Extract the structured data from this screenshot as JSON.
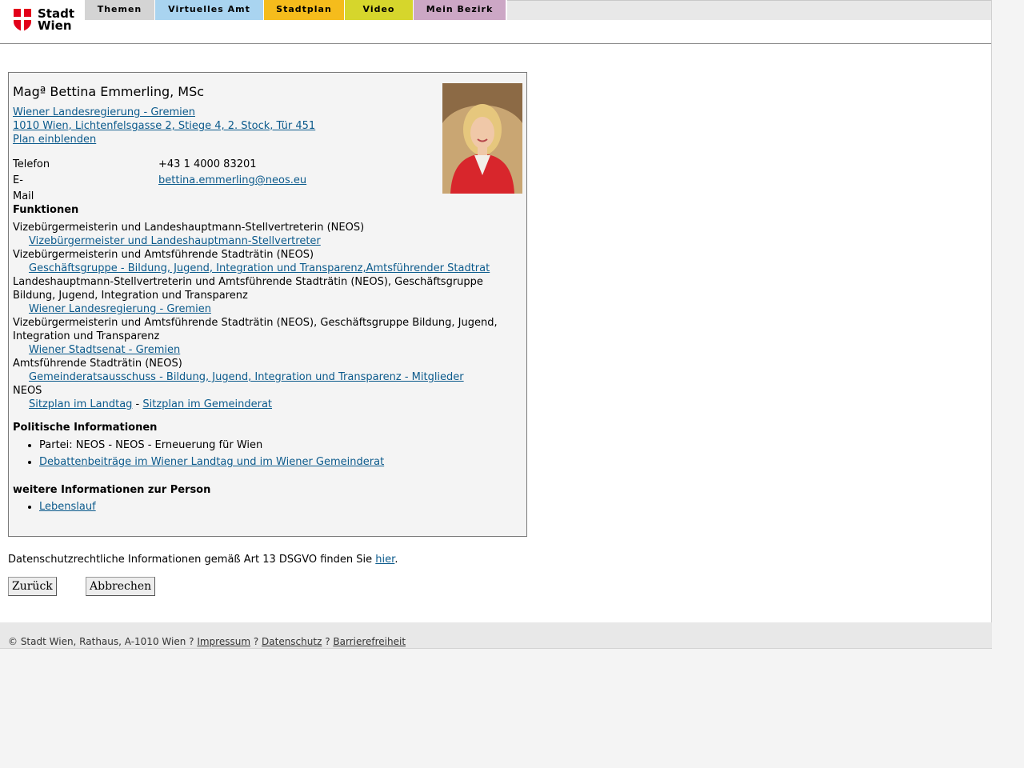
{
  "header": {
    "logo_text_line1": "Stadt",
    "logo_text_line2": "Wien",
    "tabs": [
      {
        "label": "Themen",
        "color": "#d4d4d4"
      },
      {
        "label": "Virtuelles Amt",
        "color": "#a9d4f0"
      },
      {
        "label": "Stadtplan",
        "color": "#f5bc1c"
      },
      {
        "label": "Video",
        "color": "#d6d62c"
      },
      {
        "label": "Mein Bezirk",
        "color": "#cca7c5"
      }
    ]
  },
  "person": {
    "name": "Magª Bettina Emmerling, MSc",
    "org_link": "Wiener Landesregierung - Gremien ",
    "address_link": "1010 Wien, Lichtenfelsgasse 2, Stiege 4, 2. Stock, Tür 451",
    "plan_link": "Plan einblenden",
    "phone_label": "Telefon",
    "phone_value": "+43 1 4000 83201",
    "email_label": "E-Mail",
    "email_value": "bettina.emmerling@neos.eu"
  },
  "functions": {
    "heading": "Funktionen",
    "items": [
      {
        "title": "Vizebürgermeisterin und Landeshauptmann-Stellvertreterin (NEOS)",
        "link": "Vizebürgermeister und Landeshauptmann-Stellvertreter"
      },
      {
        "title": "Vizebürgermeisterin und Amtsführende Stadträtin (NEOS)",
        "link": "Geschäftsgruppe - Bildung, Jugend, Integration und Transparenz,Amtsführender Stadtrat"
      },
      {
        "title": "Landeshauptmann-Stellvertreterin und Amtsführende Stadträtin (NEOS), Geschäftsgruppe Bildung, Jugend, Integration und Transparenz",
        "link": "Wiener Landesregierung - Gremien"
      },
      {
        "title": "Vizebürgermeisterin und Amtsführende Stadträtin (NEOS), Geschäftsgruppe Bildung, Jugend, Integration und Transparenz",
        "link": "Wiener Stadtsenat - Gremien"
      },
      {
        "title": "Amtsführende Stadträtin (NEOS)",
        "link": "Gemeinderatsausschuss - Bildung, Jugend, Integration und Transparenz - Mitglieder"
      }
    ],
    "neos_title": "NEOS",
    "seat_link_1": "Sitzplan im Landtag",
    "seat_separator": " - ",
    "seat_link_2": "Sitzplan im Gemeinderat"
  },
  "political": {
    "heading": "Politische Informationen",
    "party": "Partei: NEOS - NEOS - Erneuerung für Wien",
    "debate_link": "Debattenbeiträge im Wiener Landtag und im Wiener Gemeinderat"
  },
  "further": {
    "heading": "weitere Informationen zur Person",
    "cv_link": "Lebenslauf"
  },
  "privacy": {
    "text": "Datenschutzrechtliche Informationen gemäß Art 13 DSGVO finden Sie ",
    "link": "hier",
    "suffix": "."
  },
  "buttons": {
    "back": "Zurück",
    "cancel": "Abbrechen"
  },
  "footer": {
    "copyright": "© Stadt Wien, Rathaus, A-1010 Wien ? ",
    "impressum": "Impressum",
    "sep1": " ? ",
    "datenschutz": "Datenschutz",
    "sep2": " ? ",
    "barrierefreiheit": "Barrierefreiheit"
  }
}
